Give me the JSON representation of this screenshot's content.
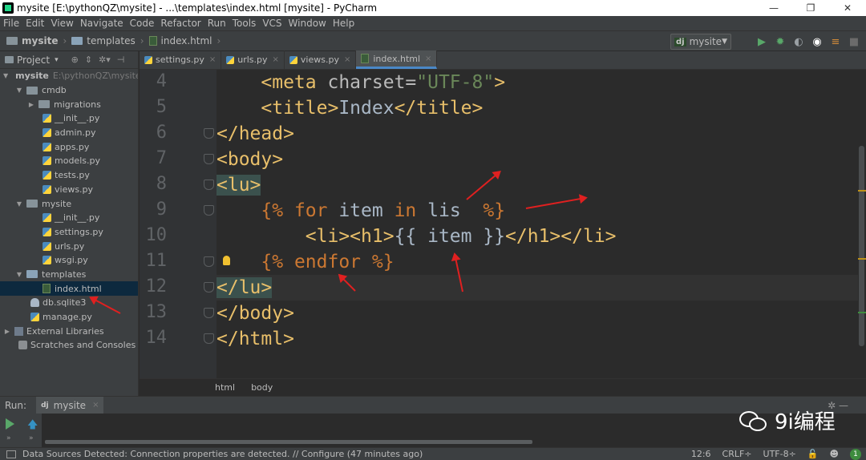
{
  "window": {
    "title": "mysite [E:\\pythonQZ\\mysite] - ...\\templates\\index.html [mysite] - PyCharm",
    "minimize": "—",
    "maximize": "❐",
    "close": "✕"
  },
  "menu": [
    "File",
    "Edit",
    "View",
    "Navigate",
    "Code",
    "Refactor",
    "Run",
    "Tools",
    "VCS",
    "Window",
    "Help"
  ],
  "breadcrumb": {
    "project": "mysite",
    "folder": "templates",
    "file": "index.html"
  },
  "run_config": {
    "icon": "dj",
    "label": "mysite"
  },
  "toolbar_icons": [
    "run-icon",
    "debug-icon",
    "coverage-icon",
    "profile-icon",
    "build-icon",
    "stop-icon"
  ],
  "project_pane": {
    "label": "Project",
    "caret": "▾"
  },
  "tree": [
    {
      "label": "mysite",
      "path": "E:\\pythonQZ\\mysite",
      "type": "folder",
      "depth": 0,
      "open": true
    },
    {
      "label": "cmdb",
      "type": "folder",
      "depth": 1,
      "open": true
    },
    {
      "label": "migrations",
      "type": "folder",
      "depth": 2,
      "open": false
    },
    {
      "label": "__init__.py",
      "type": "py",
      "depth": 3
    },
    {
      "label": "admin.py",
      "type": "py",
      "depth": 3
    },
    {
      "label": "apps.py",
      "type": "py",
      "depth": 3
    },
    {
      "label": "models.py",
      "type": "py",
      "depth": 3
    },
    {
      "label": "tests.py",
      "type": "py",
      "depth": 3
    },
    {
      "label": "views.py",
      "type": "py",
      "depth": 3
    },
    {
      "label": "mysite",
      "type": "folder",
      "depth": 1,
      "open": true
    },
    {
      "label": "__init__.py",
      "type": "py",
      "depth": 3
    },
    {
      "label": "settings.py",
      "type": "py",
      "depth": 3
    },
    {
      "label": "urls.py",
      "type": "py",
      "depth": 3
    },
    {
      "label": "wsgi.py",
      "type": "py",
      "depth": 3
    },
    {
      "label": "templates",
      "type": "folder",
      "depth": 1,
      "open": true
    },
    {
      "label": "index.html",
      "type": "html",
      "depth": 3,
      "selected": true
    },
    {
      "label": "db.sqlite3",
      "type": "db",
      "depth": 2
    },
    {
      "label": "manage.py",
      "type": "py",
      "depth": 2
    },
    {
      "label": "External Libraries",
      "type": "lib",
      "depth": 0,
      "open": false
    },
    {
      "label": "Scratches and Consoles",
      "type": "scratch",
      "depth": 1
    }
  ],
  "tabs": [
    {
      "label": "settings.py",
      "active": false
    },
    {
      "label": "urls.py",
      "active": false
    },
    {
      "label": "views.py",
      "active": false
    },
    {
      "label": "index.html",
      "active": true
    }
  ],
  "code_lines": [
    {
      "num": "4",
      "segments": [
        [
          "txt",
          "    "
        ],
        [
          "tag",
          "<meta "
        ],
        [
          "attr",
          "charset="
        ],
        [
          "str",
          "\"UTF-8\""
        ],
        [
          "tag",
          ">"
        ]
      ]
    },
    {
      "num": "5",
      "segments": [
        [
          "txt",
          "    "
        ],
        [
          "tag",
          "<title>"
        ],
        [
          "txt",
          "Index"
        ],
        [
          "tag",
          "</title>"
        ]
      ]
    },
    {
      "num": "6",
      "segments": [
        [
          "tag",
          "</head>"
        ]
      ]
    },
    {
      "num": "7",
      "segments": [
        [
          "tag",
          "<body>"
        ]
      ]
    },
    {
      "num": "8",
      "segments": [
        [
          "lumatch",
          "<lu>"
        ]
      ]
    },
    {
      "num": "9",
      "segments": [
        [
          "txt",
          "    "
        ],
        [
          "kw",
          "{% "
        ],
        [
          "kw",
          "for"
        ],
        [
          "txt",
          " item "
        ],
        [
          "kw",
          "in"
        ],
        [
          "txt",
          " lis  "
        ],
        [
          "kw",
          "%}"
        ]
      ]
    },
    {
      "num": "10",
      "segments": [
        [
          "txt",
          "        "
        ],
        [
          "tag",
          "<li><h1>"
        ],
        [
          "txt",
          "{{ item }}"
        ],
        [
          "tag",
          "</h1></li>"
        ]
      ]
    },
    {
      "num": "11",
      "segments": [
        [
          "txt",
          "    "
        ],
        [
          "kw",
          "{% "
        ],
        [
          "kw",
          "endfor"
        ],
        [
          "kw",
          " %}"
        ]
      ]
    },
    {
      "num": "12",
      "segments": [
        [
          "lumatch",
          "</lu>"
        ]
      ],
      "current": true
    },
    {
      "num": "13",
      "segments": [
        [
          "tag",
          "</body>"
        ]
      ]
    },
    {
      "num": "14",
      "segments": [
        [
          "tag",
          "</html>"
        ]
      ]
    }
  ],
  "editor_breadcrumb": [
    "html",
    "body"
  ],
  "run_panel": {
    "label": "Run:",
    "tab_icon": "dj",
    "tab_label": "mysite",
    "close": "×"
  },
  "watermark": "9i编程",
  "status": {
    "message": "Data Sources Detected: Connection properties are detected. // Configure (47 minutes ago)",
    "position": "12:6",
    "line_sep": "CRLF÷",
    "encoding": "UTF-8÷",
    "notifications": "1"
  },
  "colors": {
    "tag": "#e8bf6a",
    "keyword": "#cc7832",
    "string": "#6a8759",
    "text": "#a9b7c6",
    "annotation_arrow": "#e02020"
  }
}
